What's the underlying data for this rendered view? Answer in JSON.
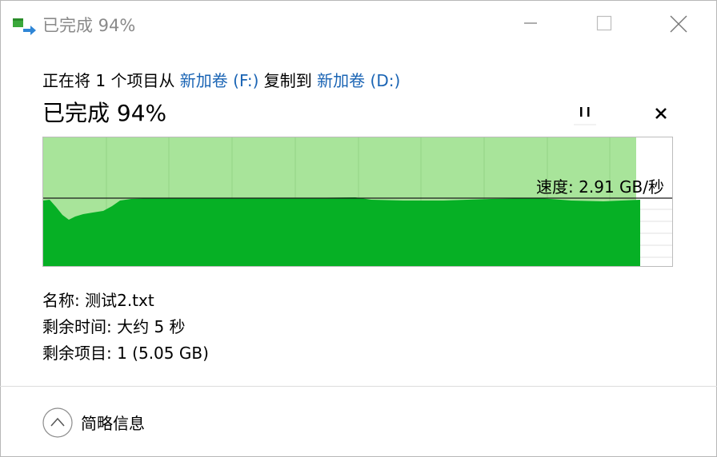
{
  "window": {
    "title": "已完成 94%",
    "minimize_icon": "minimize-icon",
    "maximize_icon": "maximize-icon",
    "close_icon": "close-icon"
  },
  "copy": {
    "desc_prefix": "正在将 1 个项目从 ",
    "source": "新加卷 (F:)",
    "desc_middle": " 复制到 ",
    "destination": "新加卷 (D:)",
    "progress_label": "已完成 94%",
    "progress_percent": 94,
    "pause_icon": "pause-icon",
    "cancel_icon": "close-icon"
  },
  "graph": {
    "speed_label": "速度: 2.91 GB/秒",
    "fill_color": "#06b025",
    "background_fill_color": "#a8e49a"
  },
  "details": {
    "name": "名称: 测试2.txt",
    "time_remaining": "剩余时间: 大约 5 秒",
    "items_remaining": "剩余项目: 1 (5.05 GB)"
  },
  "footer": {
    "toggle_label": "简略信息",
    "toggle_icon": "chevron-up-icon"
  }
}
